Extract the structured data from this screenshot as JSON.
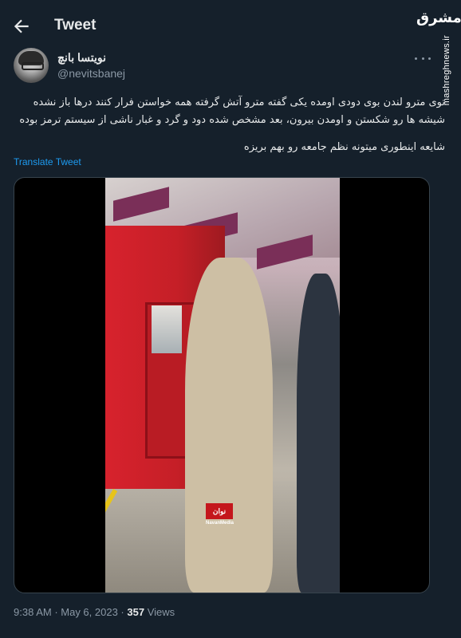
{
  "header": {
    "title": "Tweet"
  },
  "watermark": {
    "logo": "مشرق",
    "url": "mashreghnews.ir"
  },
  "author": {
    "name": "نویتسا بانچ",
    "handle": "@nevitsbanej"
  },
  "tweet": {
    "line1": "توی مترو لندن بوی دودی اومده یکی گفته مترو آتش گرفته همه خواستن فرار کنند درها باز نشده شیشه ها رو شکستن و اومدن بیرون، بعد مشخص شده دود و گرد و غبار ناشی از سیستم ترمز بوده",
    "line2": "شایعه اینطوری میتونه نظم جامعه رو بهم بریزه",
    "translate": "Translate Tweet"
  },
  "media": {
    "logo": "نوان",
    "logo_caption": "NavanMedia"
  },
  "meta": {
    "time": "9:38 AM",
    "sep1": " · ",
    "date": "May 6, 2023",
    "sep2": " · ",
    "views_count": "357",
    "views_label": " Views"
  }
}
